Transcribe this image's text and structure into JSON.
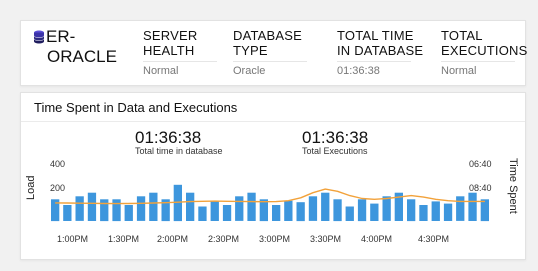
{
  "summary": {
    "db_name": "ER-ORACLE",
    "db_name_line1": "ER-",
    "db_name_line2": "ORACLE",
    "metrics": [
      {
        "label_line1": "SERVER",
        "label_line2": "HEALTH",
        "value": "Normal"
      },
      {
        "label_line1": "DATABASE",
        "label_line2": "TYPE",
        "value": "Oracle"
      },
      {
        "label_line1": "TOTAL TIME",
        "label_line2": "IN DATABASE",
        "value": "01:36:38"
      },
      {
        "label_line1": "TOTAL",
        "label_line2": "EXECUTIONS",
        "value": "Normal"
      }
    ]
  },
  "chart_panel": {
    "title": "Time Spent in Data and Executions",
    "stats": [
      {
        "value": "01:36:38",
        "caption": "Total time in database"
      },
      {
        "value": "01:36:38",
        "caption": "Total Executions"
      }
    ]
  },
  "chart_data": {
    "type": "bar",
    "ylabel": "Load",
    "y2label": "Time Spent",
    "ylim": [
      0,
      400
    ],
    "yticks": [
      "400",
      "200"
    ],
    "y2ticks": [
      "06:40",
      "08:40"
    ],
    "xticks": [
      "1:00PM",
      "1:30PM",
      "2:00PM",
      "2:30PM",
      "3:00PM",
      "3:30PM",
      "4:00PM",
      "4:30PM"
    ],
    "bar_color": "#3d96dd",
    "line_color": "#f2a23b",
    "series": [
      {
        "type": "bar",
        "values": [
          150,
          110,
          170,
          195,
          150,
          150,
          110,
          170,
          195,
          150,
          250,
          195,
          100,
          135,
          110,
          170,
          195,
          150,
          110,
          140,
          130,
          170,
          195,
          150,
          100,
          150,
          120,
          170,
          195,
          150,
          110,
          135,
          120,
          170,
          195,
          150
        ]
      },
      {
        "type": "line",
        "values": [
          125,
          124,
          123,
          122,
          121,
          120,
          121,
          122,
          124,
          126,
          130,
          134,
          136,
          137,
          136,
          135,
          134,
          133,
          134,
          140,
          160,
          195,
          220,
          205,
          175,
          155,
          150,
          155,
          165,
          175,
          165,
          150,
          140,
          135,
          135,
          135
        ]
      }
    ]
  }
}
